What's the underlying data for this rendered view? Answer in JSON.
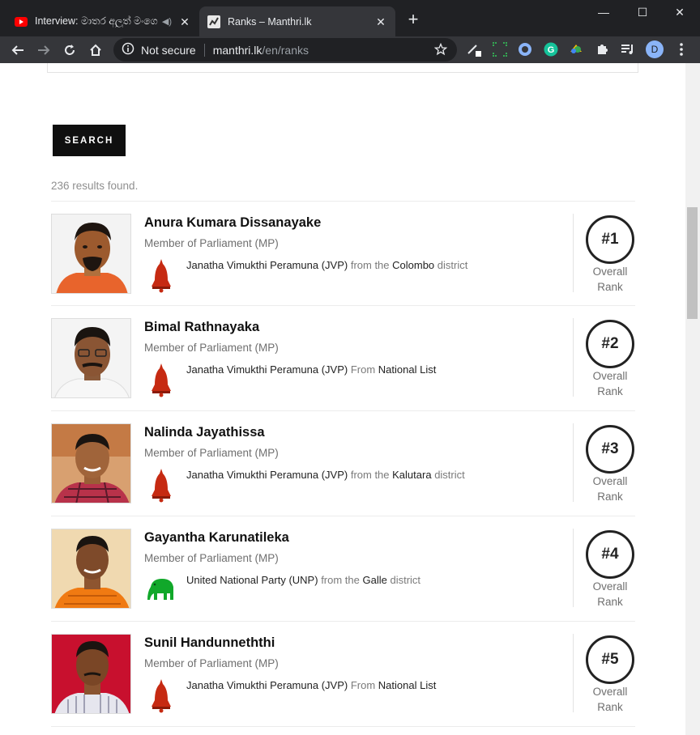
{
  "browser": {
    "tabs": [
      {
        "title": "Interview: මාතර අලුත් මංගෙ"
      },
      {
        "title": "Ranks – Manthri.lk"
      }
    ],
    "omnibox": {
      "security": "Not secure",
      "domain": "manthri.lk",
      "path": "/en/ranks"
    },
    "profile_initial": "D"
  },
  "page": {
    "search_label": "SEARCH",
    "results_text": "236 results found.",
    "rank_label_line1": "Overall",
    "rank_label_line2": "Rank",
    "members": [
      {
        "rank": "#1",
        "name": "Anura Kumara Dissanayake",
        "role": "Member of Parliament (MP)",
        "party": "Janatha Vimukthi Peramuna (JVP)",
        "connector": "from the",
        "place": "Colombo",
        "place_suffix": "district",
        "logo": "bell-icon"
      },
      {
        "rank": "#2",
        "name": "Bimal Rathnayaka",
        "role": "Member of Parliament (MP)",
        "party": "Janatha Vimukthi Peramuna (JVP)",
        "connector": "From",
        "place": "National List",
        "place_suffix": "",
        "logo": "bell-icon"
      },
      {
        "rank": "#3",
        "name": "Nalinda Jayathissa",
        "role": "Member of Parliament (MP)",
        "party": "Janatha Vimukthi Peramuna (JVP)",
        "connector": "from the",
        "place": "Kalutara",
        "place_suffix": "district",
        "logo": "bell-icon"
      },
      {
        "rank": "#4",
        "name": "Gayantha Karunatileka",
        "role": "Member of Parliament (MP)",
        "party": "United National Party (UNP)",
        "connector": "from the",
        "place": "Galle",
        "place_suffix": "district",
        "logo": "elephant-icon"
      },
      {
        "rank": "#5",
        "name": "Sunil Handunneththi",
        "role": "Member of Parliament (MP)",
        "party": "Janatha Vimukthi Peramuna (JVP)",
        "connector": "From",
        "place": "National List",
        "place_suffix": "",
        "logo": "bell-icon"
      }
    ]
  },
  "colors": {
    "chrome_dark": "#202124",
    "chrome_toolbar": "#35363a",
    "bell_red": "#c62a12",
    "elephant_green": "#11a82a",
    "rank_ring": "#222222"
  }
}
